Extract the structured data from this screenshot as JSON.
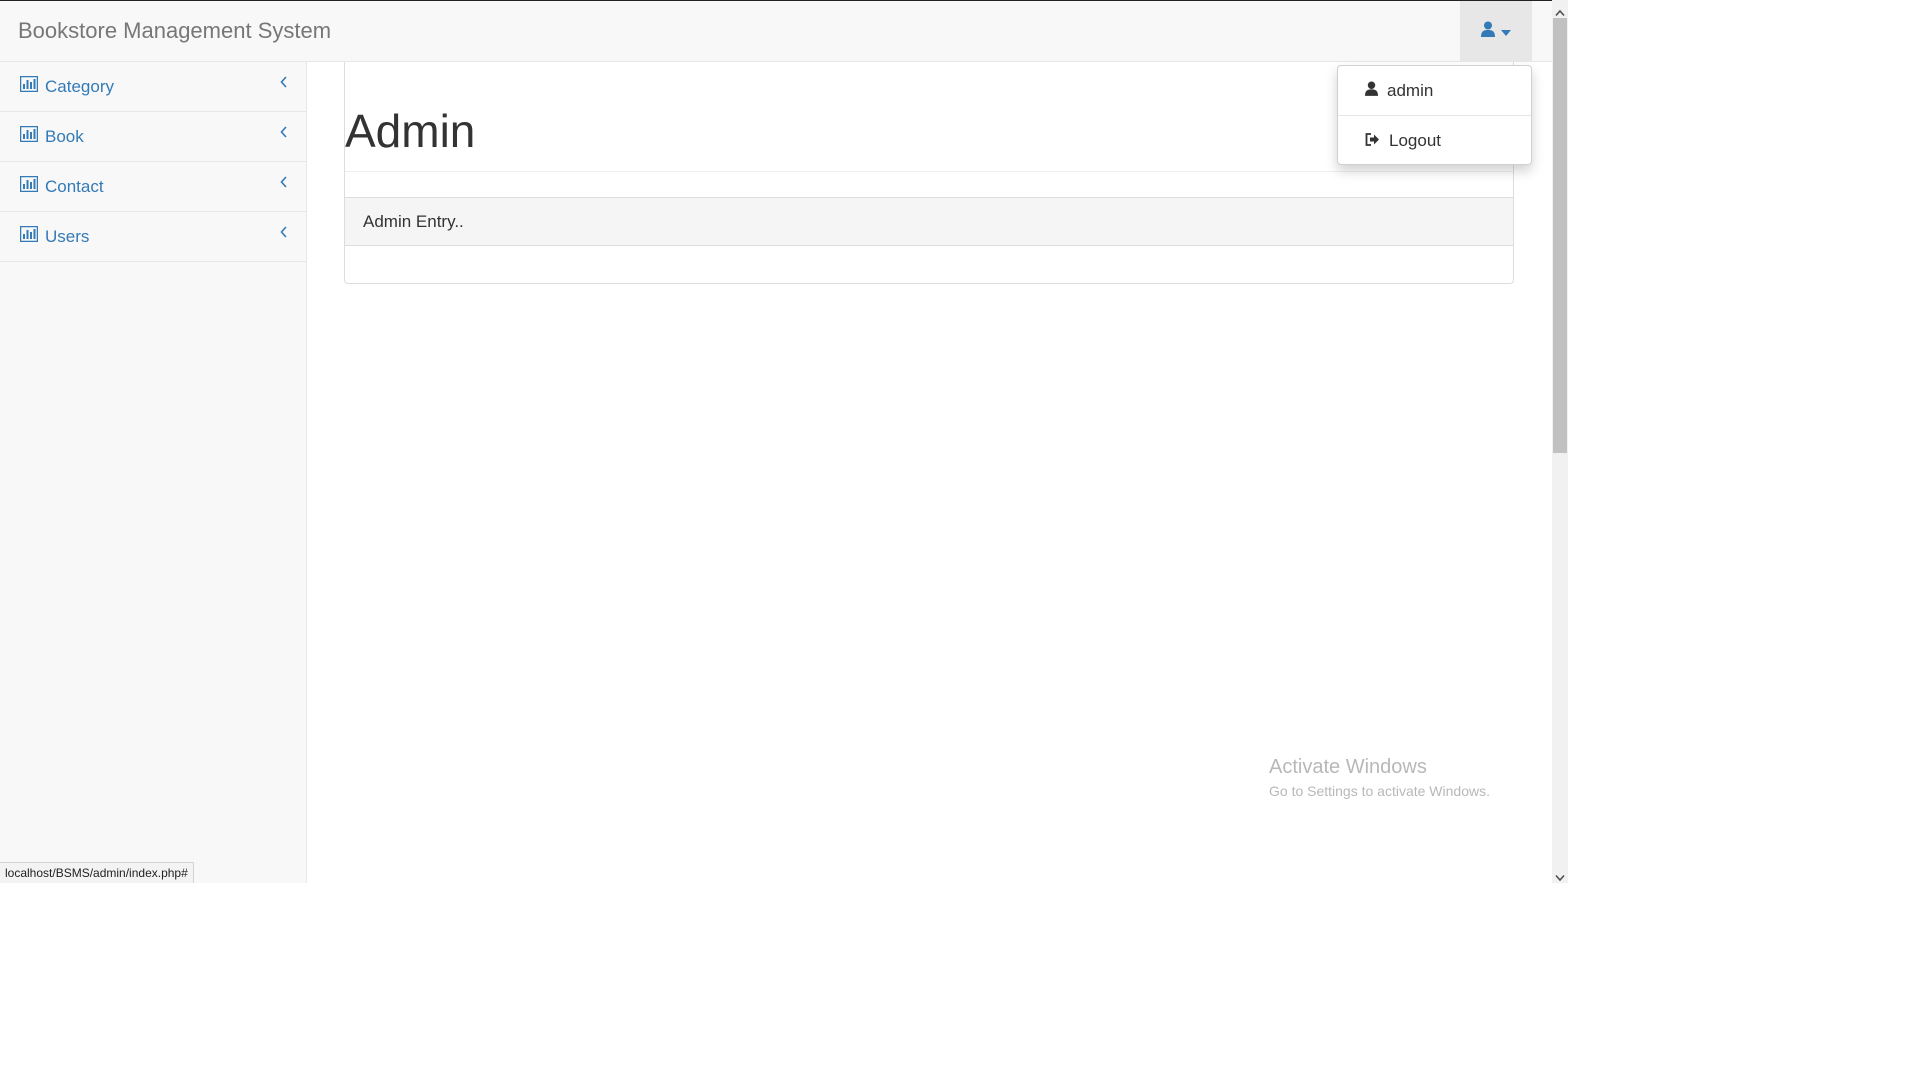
{
  "header": {
    "brand": "Bookstore Management System",
    "user_icon": "user-icon",
    "caret_icon": "caret-down-icon"
  },
  "sidebar": {
    "items": [
      {
        "label": "Category",
        "icon": "bar-chart-icon"
      },
      {
        "label": "Book",
        "icon": "bar-chart-icon"
      },
      {
        "label": "Contact",
        "icon": "bar-chart-icon"
      },
      {
        "label": "Users",
        "icon": "bar-chart-icon"
      }
    ]
  },
  "main": {
    "title": "Admin",
    "panel_heading": "Admin Entry.."
  },
  "user_menu": {
    "items": [
      {
        "label": "admin",
        "icon": "user-icon"
      },
      {
        "label": "Logout",
        "icon": "sign-out-icon"
      }
    ]
  },
  "watermark": {
    "title": "Activate Windows",
    "subtitle": "Go to Settings to activate Windows."
  },
  "status_url": "localhost/BSMS/admin/index.php#",
  "colors": {
    "link": "#337ab7",
    "navbar_bg": "#f8f8f8",
    "brand_text": "#777777"
  }
}
